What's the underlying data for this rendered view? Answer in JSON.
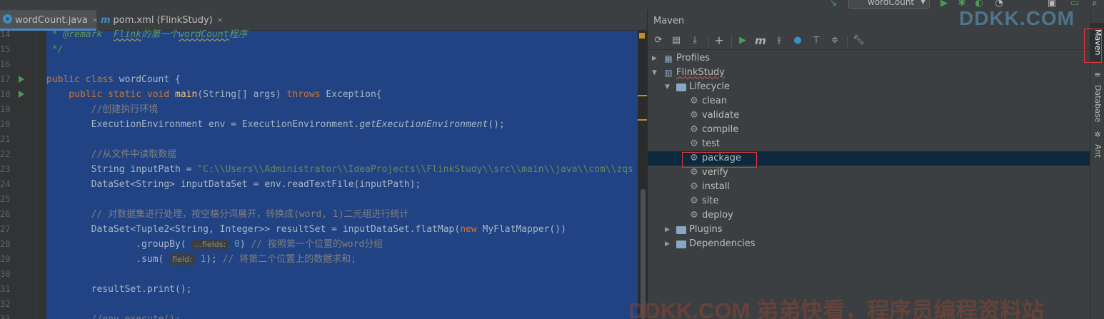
{
  "toolbar": {
    "run_config": "wordCount"
  },
  "tabs": [
    {
      "label": "wordCount.java"
    },
    {
      "label": "pom.xml (FlinkStudy)"
    }
  ],
  "code": {
    "lines": [
      {
        "n": "14",
        "parts": [
          {
            "t": " * @remark  ",
            "c": "cm-i"
          },
          {
            "t": "Flink",
            "c": "cm-i squig"
          },
          {
            "t": "的第一个",
            "c": "cm-i"
          },
          {
            "t": "wordCount",
            "c": "cm-i squig"
          },
          {
            "t": "程序",
            "c": "cm-i"
          }
        ]
      },
      {
        "n": "15",
        "parts": [
          {
            "t": " */",
            "c": "cm-i"
          }
        ]
      },
      {
        "n": "16",
        "parts": []
      },
      {
        "n": "17",
        "run": true,
        "parts": [
          {
            "t": "public class ",
            "c": "kw"
          },
          {
            "t": "wordCount {",
            "c": ""
          }
        ]
      },
      {
        "n": "18",
        "run": true,
        "parts": [
          {
            "t": "    public static void ",
            "c": "kw"
          },
          {
            "t": "main",
            "c": "fn"
          },
          {
            "t": "(String[] args) ",
            "c": ""
          },
          {
            "t": "throws ",
            "c": "kw"
          },
          {
            "t": "Exception{",
            "c": ""
          }
        ]
      },
      {
        "n": "19",
        "parts": [
          {
            "t": "        //创建执行环境",
            "c": "cm"
          }
        ]
      },
      {
        "n": "20",
        "parts": [
          {
            "t": "        ExecutionEnvironment env = ExecutionEnvironment.",
            "c": ""
          },
          {
            "t": "getExecutionEnvironment",
            "c": "it"
          },
          {
            "t": "();",
            "c": ""
          }
        ]
      },
      {
        "n": "21",
        "parts": []
      },
      {
        "n": "22",
        "parts": [
          {
            "t": "        //从文件中读取数据",
            "c": "cm"
          }
        ]
      },
      {
        "n": "23",
        "parts": [
          {
            "t": "        String inputPath = ",
            "c": ""
          },
          {
            "t": "\"C:\\\\Users\\\\Administrator\\\\IdeaProjects\\\\FlinkStudy\\\\src\\\\main\\\\java\\\\com\\\\zqs",
            "c": "str"
          }
        ]
      },
      {
        "n": "24",
        "parts": [
          {
            "t": "        DataSet<String> inputDataSet = env.readTextFile(inputPath);",
            "c": ""
          }
        ]
      },
      {
        "n": "25",
        "parts": []
      },
      {
        "n": "26",
        "parts": [
          {
            "t": "        // 对数据集进行处理，按空格分词展开，转换成(word, 1)二元组进行统计",
            "c": "cm"
          }
        ]
      },
      {
        "n": "27",
        "parts": [
          {
            "t": "        DataSet<Tuple2<String, Integer>> resultSet = inputDataSet.flatMap(",
            "c": ""
          },
          {
            "t": "new ",
            "c": "kw"
          },
          {
            "t": "MyFlatMapper())",
            "c": ""
          }
        ]
      },
      {
        "n": "28",
        "parts": [
          {
            "t": "                .groupBy( ",
            "c": ""
          },
          {
            "hint": "...fields:"
          },
          {
            "t": " 0",
            "c": "num"
          },
          {
            "t": ") ",
            "c": ""
          },
          {
            "t": "// 按照第一个位置的word分组",
            "c": "cm"
          }
        ]
      },
      {
        "n": "29",
        "parts": [
          {
            "t": "                .sum( ",
            "c": ""
          },
          {
            "hint": "field:"
          },
          {
            "t": " 1",
            "c": "num"
          },
          {
            "t": "); ",
            "c": ""
          },
          {
            "t": "// 将第二个位置上的数据求和;",
            "c": "cm"
          }
        ]
      },
      {
        "n": "30",
        "parts": []
      },
      {
        "n": "31",
        "parts": [
          {
            "t": "        resultSet.print();",
            "c": ""
          }
        ]
      },
      {
        "n": "32",
        "parts": []
      },
      {
        "n": "33",
        "parts": [
          {
            "t": "        //env.execute();",
            "c": "cm"
          }
        ]
      }
    ]
  },
  "maven": {
    "title": "Maven",
    "tree": [
      {
        "label": "Profiles",
        "depth": 0,
        "arrow": "right",
        "icon": "profiles-icon"
      },
      {
        "label": "FlinkStudy",
        "depth": 0,
        "arrow": "down",
        "icon": "maven-project-icon"
      },
      {
        "label": "Lifecycle",
        "depth": 1,
        "arrow": "down",
        "icon": "folder-icon"
      },
      {
        "label": "clean",
        "depth": 2,
        "icon": "gear-icon"
      },
      {
        "label": "validate",
        "depth": 2,
        "icon": "gear-icon"
      },
      {
        "label": "compile",
        "depth": 2,
        "icon": "gear-icon"
      },
      {
        "label": "test",
        "depth": 2,
        "icon": "gear-icon"
      },
      {
        "label": "package",
        "depth": 2,
        "icon": "gear-icon",
        "selected": true
      },
      {
        "label": "verify",
        "depth": 2,
        "icon": "gear-icon"
      },
      {
        "label": "install",
        "depth": 2,
        "icon": "gear-icon"
      },
      {
        "label": "site",
        "depth": 2,
        "icon": "gear-icon"
      },
      {
        "label": "deploy",
        "depth": 2,
        "icon": "gear-icon"
      },
      {
        "label": "Plugins",
        "depth": 1,
        "arrow": "right",
        "icon": "folder-icon"
      },
      {
        "label": "Dependencies",
        "depth": 1,
        "arrow": "right",
        "icon": "folder-icon"
      }
    ]
  },
  "side": {
    "maven_label": "Maven",
    "database_label": "Database",
    "ant_label": "Ant"
  },
  "watermark": {
    "top": "DDKK.COM",
    "bottom": "DDKK.COM 弟弟快看，程序员编程资料站"
  },
  "colors": {
    "selection": "#214283",
    "tree_selected": "#0d293e",
    "highlight_box": "#e53935"
  }
}
